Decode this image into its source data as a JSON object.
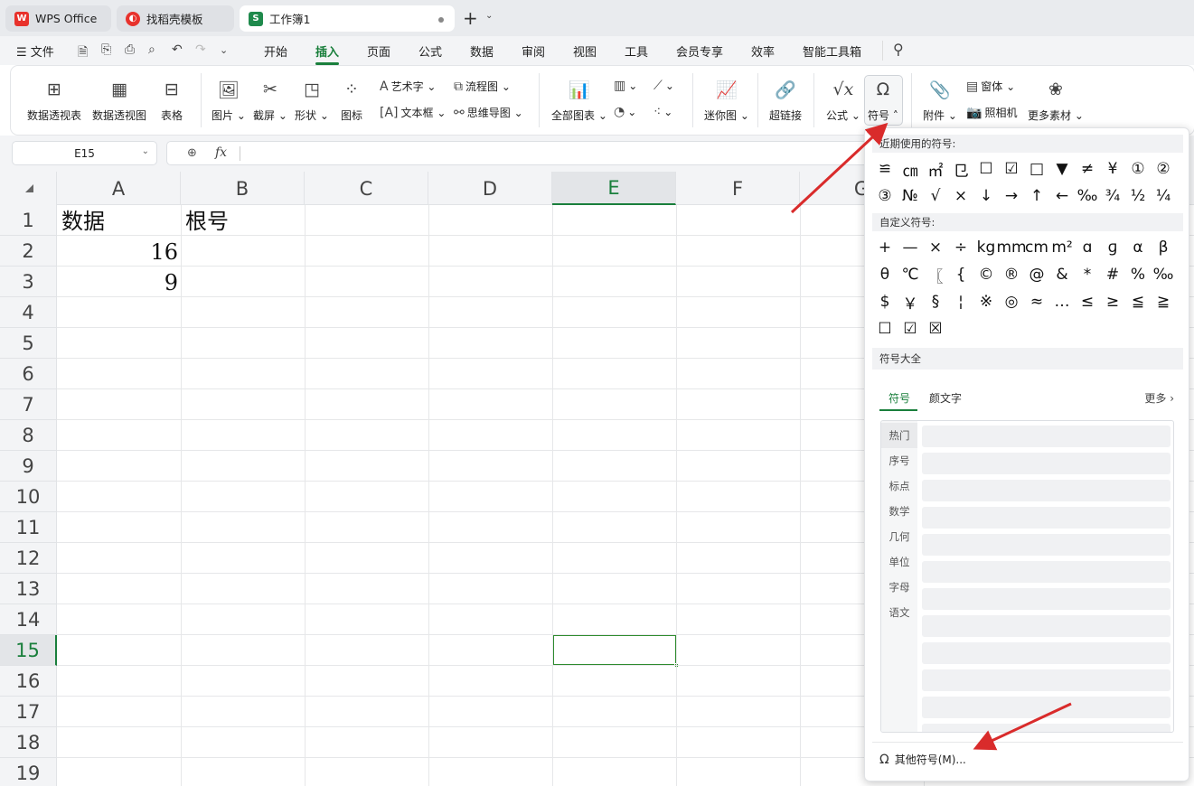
{
  "tabs": {
    "wps": "WPS Office",
    "template": "找稻壳模板",
    "workbook": "工作簿1"
  },
  "menubar": {
    "file": "文件",
    "items": [
      "开始",
      "插入",
      "页面",
      "公式",
      "数据",
      "审阅",
      "视图",
      "工具",
      "会员专享",
      "效率",
      "智能工具箱"
    ],
    "active": "插入"
  },
  "ribbon": {
    "pivot_table": "数据透视表",
    "pivot_chart": "数据透视图",
    "table": "表格",
    "picture": "图片",
    "screenshot": "截屏",
    "shape": "形状",
    "icon": "图标",
    "art_text": "艺术字",
    "textbox": "文本框",
    "flowchart": "流程图",
    "mindmap": "思维导图",
    "all_charts": "全部图表",
    "sparkline": "迷你图",
    "hyperlink": "超链接",
    "formula": "公式",
    "symbol": "符号",
    "attachment": "附件",
    "form": "窗体",
    "camera": "照相机",
    "more_material": "更多素材"
  },
  "formula_bar": {
    "cell_ref": "E15",
    "fx": "fx",
    "content": ""
  },
  "grid": {
    "columns": [
      "A",
      "B",
      "C",
      "D",
      "E",
      "F",
      "G"
    ],
    "selected_column": "E",
    "rows": [
      "1",
      "2",
      "3",
      "4",
      "5",
      "6",
      "7",
      "8",
      "9",
      "10",
      "11",
      "12",
      "13",
      "14",
      "15",
      "16",
      "17",
      "18",
      "19"
    ],
    "selected_row": "15",
    "cells": {
      "A1": "数据",
      "B1": "根号",
      "A2": "16",
      "A3": "9"
    }
  },
  "symbol_popup": {
    "recent_title": "近期使用的符号:",
    "recent": [
      "≌",
      "㎝",
      "㎡",
      "⺋",
      "☐",
      "☑",
      "□",
      "▼",
      "≠",
      "¥",
      "①",
      "②",
      "③",
      "№",
      "√",
      "×",
      "↓",
      "→",
      "↑",
      "←",
      "‰",
      "¾",
      "½",
      "¼"
    ],
    "custom_title": "自定义符号:",
    "custom": [
      "+",
      "—",
      "×",
      "÷",
      "kg",
      "mm",
      "cm",
      "m²",
      "ɑ",
      "ɡ",
      "α",
      "β",
      "θ",
      "℃",
      "〖",
      "{",
      "©",
      "®",
      "@",
      "&",
      "*",
      "#",
      "%",
      "‰",
      "$",
      "￥",
      "§",
      "¦",
      "※",
      "◎",
      "≈",
      "…",
      "≤",
      "≥",
      "≦",
      "≧",
      "☐",
      "☑",
      "☒"
    ],
    "all_title": "符号大全",
    "tab_symbol": "符号",
    "tab_kaomoji": "颜文字",
    "more": "更多",
    "categories": [
      "热门",
      "序号",
      "标点",
      "数学",
      "几何",
      "单位",
      "字母",
      "语文"
    ],
    "other_symbols": "其他符号(M)..."
  },
  "colors": {
    "accent": "#1a7f3c",
    "arrow": "#d92b2b",
    "selection": "#2e8b2e"
  }
}
